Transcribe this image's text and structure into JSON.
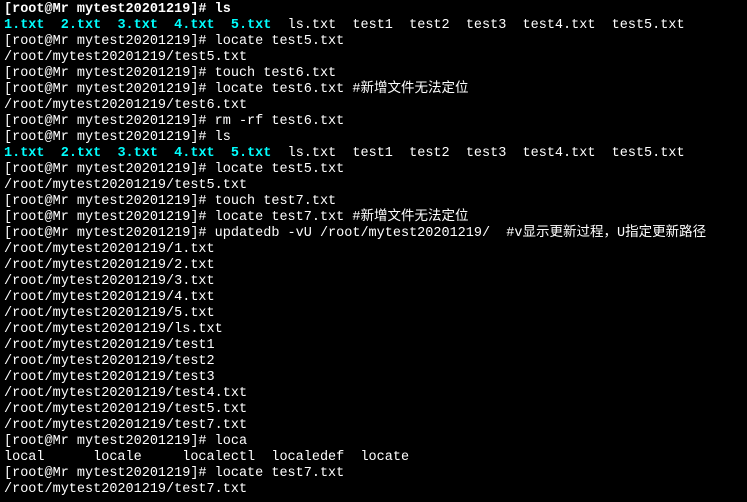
{
  "terminal": {
    "lines": [
      {
        "segments": [
          {
            "text": "",
            "cls": "white"
          }
        ]
      },
      {
        "segments": [
          {
            "text": "[root@Mr mytest20201219]# ls",
            "cls": "white b"
          }
        ]
      },
      {
        "segments": [
          {
            "text": "1.txt",
            "cls": "cyan"
          },
          {
            "text": "  ",
            "cls": "white"
          },
          {
            "text": "2.txt",
            "cls": "cyan"
          },
          {
            "text": "  ",
            "cls": "white"
          },
          {
            "text": "3.txt",
            "cls": "cyan"
          },
          {
            "text": "  ",
            "cls": "white"
          },
          {
            "text": "4.txt",
            "cls": "cyan"
          },
          {
            "text": "  ",
            "cls": "white"
          },
          {
            "text": "5.txt",
            "cls": "cyan"
          },
          {
            "text": "  ",
            "cls": "white"
          },
          {
            "text": "ls.txt  test1  test2  test3  test4.txt  test5.txt",
            "cls": "white"
          }
        ]
      },
      {
        "segments": [
          {
            "text": "[root@Mr mytest20201219]# locate test5.txt",
            "cls": "white"
          }
        ]
      },
      {
        "segments": [
          {
            "text": "/root/mytest20201219/test5.txt",
            "cls": "white"
          }
        ]
      },
      {
        "segments": [
          {
            "text": "[root@Mr mytest20201219]# touch test6.txt",
            "cls": "white"
          }
        ]
      },
      {
        "segments": [
          {
            "text": "[root@Mr mytest20201219]# locate test6.txt #新增文件无法定位",
            "cls": "white"
          }
        ]
      },
      {
        "segments": [
          {
            "text": "/root/mytest20201219/test6.txt",
            "cls": "white"
          }
        ]
      },
      {
        "segments": [
          {
            "text": "[root@Mr mytest20201219]# rm -rf test6.txt",
            "cls": "white"
          }
        ]
      },
      {
        "segments": [
          {
            "text": "[root@Mr mytest20201219]# ls",
            "cls": "white"
          }
        ]
      },
      {
        "segments": [
          {
            "text": "1.txt",
            "cls": "cyan"
          },
          {
            "text": "  ",
            "cls": "white"
          },
          {
            "text": "2.txt",
            "cls": "cyan"
          },
          {
            "text": "  ",
            "cls": "white"
          },
          {
            "text": "3.txt",
            "cls": "cyan"
          },
          {
            "text": "  ",
            "cls": "white"
          },
          {
            "text": "4.txt",
            "cls": "cyan"
          },
          {
            "text": "  ",
            "cls": "white"
          },
          {
            "text": "5.txt",
            "cls": "cyan"
          },
          {
            "text": "  ",
            "cls": "white"
          },
          {
            "text": "ls.txt  test1  test2  test3  test4.txt  test5.txt",
            "cls": "white"
          }
        ]
      },
      {
        "segments": [
          {
            "text": "[root@Mr mytest20201219]# locate test5.txt",
            "cls": "white"
          }
        ]
      },
      {
        "segments": [
          {
            "text": "/root/mytest20201219/test5.txt",
            "cls": "white"
          }
        ]
      },
      {
        "segments": [
          {
            "text": "[root@Mr mytest20201219]# touch test7.txt",
            "cls": "white"
          }
        ]
      },
      {
        "segments": [
          {
            "text": "[root@Mr mytest20201219]# locate test7.txt #新增文件无法定位",
            "cls": "white"
          }
        ]
      },
      {
        "segments": [
          {
            "text": "[root@Mr mytest20201219]# updatedb -vU /root/mytest20201219/  #v显示更新过程，U指定更新路径",
            "cls": "white"
          }
        ]
      },
      {
        "segments": [
          {
            "text": "/root/mytest20201219/1.txt",
            "cls": "white"
          }
        ]
      },
      {
        "segments": [
          {
            "text": "/root/mytest20201219/2.txt",
            "cls": "white"
          }
        ]
      },
      {
        "segments": [
          {
            "text": "/root/mytest20201219/3.txt",
            "cls": "white"
          }
        ]
      },
      {
        "segments": [
          {
            "text": "/root/mytest20201219/4.txt",
            "cls": "white"
          }
        ]
      },
      {
        "segments": [
          {
            "text": "/root/mytest20201219/5.txt",
            "cls": "white"
          }
        ]
      },
      {
        "segments": [
          {
            "text": "/root/mytest20201219/ls.txt",
            "cls": "white"
          }
        ]
      },
      {
        "segments": [
          {
            "text": "/root/mytest20201219/test1",
            "cls": "white"
          }
        ]
      },
      {
        "segments": [
          {
            "text": "/root/mytest20201219/test2",
            "cls": "white"
          }
        ]
      },
      {
        "segments": [
          {
            "text": "/root/mytest20201219/test3",
            "cls": "white"
          }
        ]
      },
      {
        "segments": [
          {
            "text": "/root/mytest20201219/test4.txt",
            "cls": "white"
          }
        ]
      },
      {
        "segments": [
          {
            "text": "/root/mytest20201219/test5.txt",
            "cls": "white"
          }
        ]
      },
      {
        "segments": [
          {
            "text": "/root/mytest20201219/test7.txt",
            "cls": "white"
          }
        ]
      },
      {
        "segments": [
          {
            "text": "[root@Mr mytest20201219]# loca",
            "cls": "white"
          }
        ]
      },
      {
        "segments": [
          {
            "text": "local      locale     localectl  localedef  locate",
            "cls": "white"
          }
        ]
      },
      {
        "segments": [
          {
            "text": "[root@Mr mytest20201219]# locate test7.txt",
            "cls": "white"
          }
        ]
      },
      {
        "segments": [
          {
            "text": "/root/mytest20201219/test7.txt",
            "cls": "white"
          }
        ]
      }
    ]
  }
}
